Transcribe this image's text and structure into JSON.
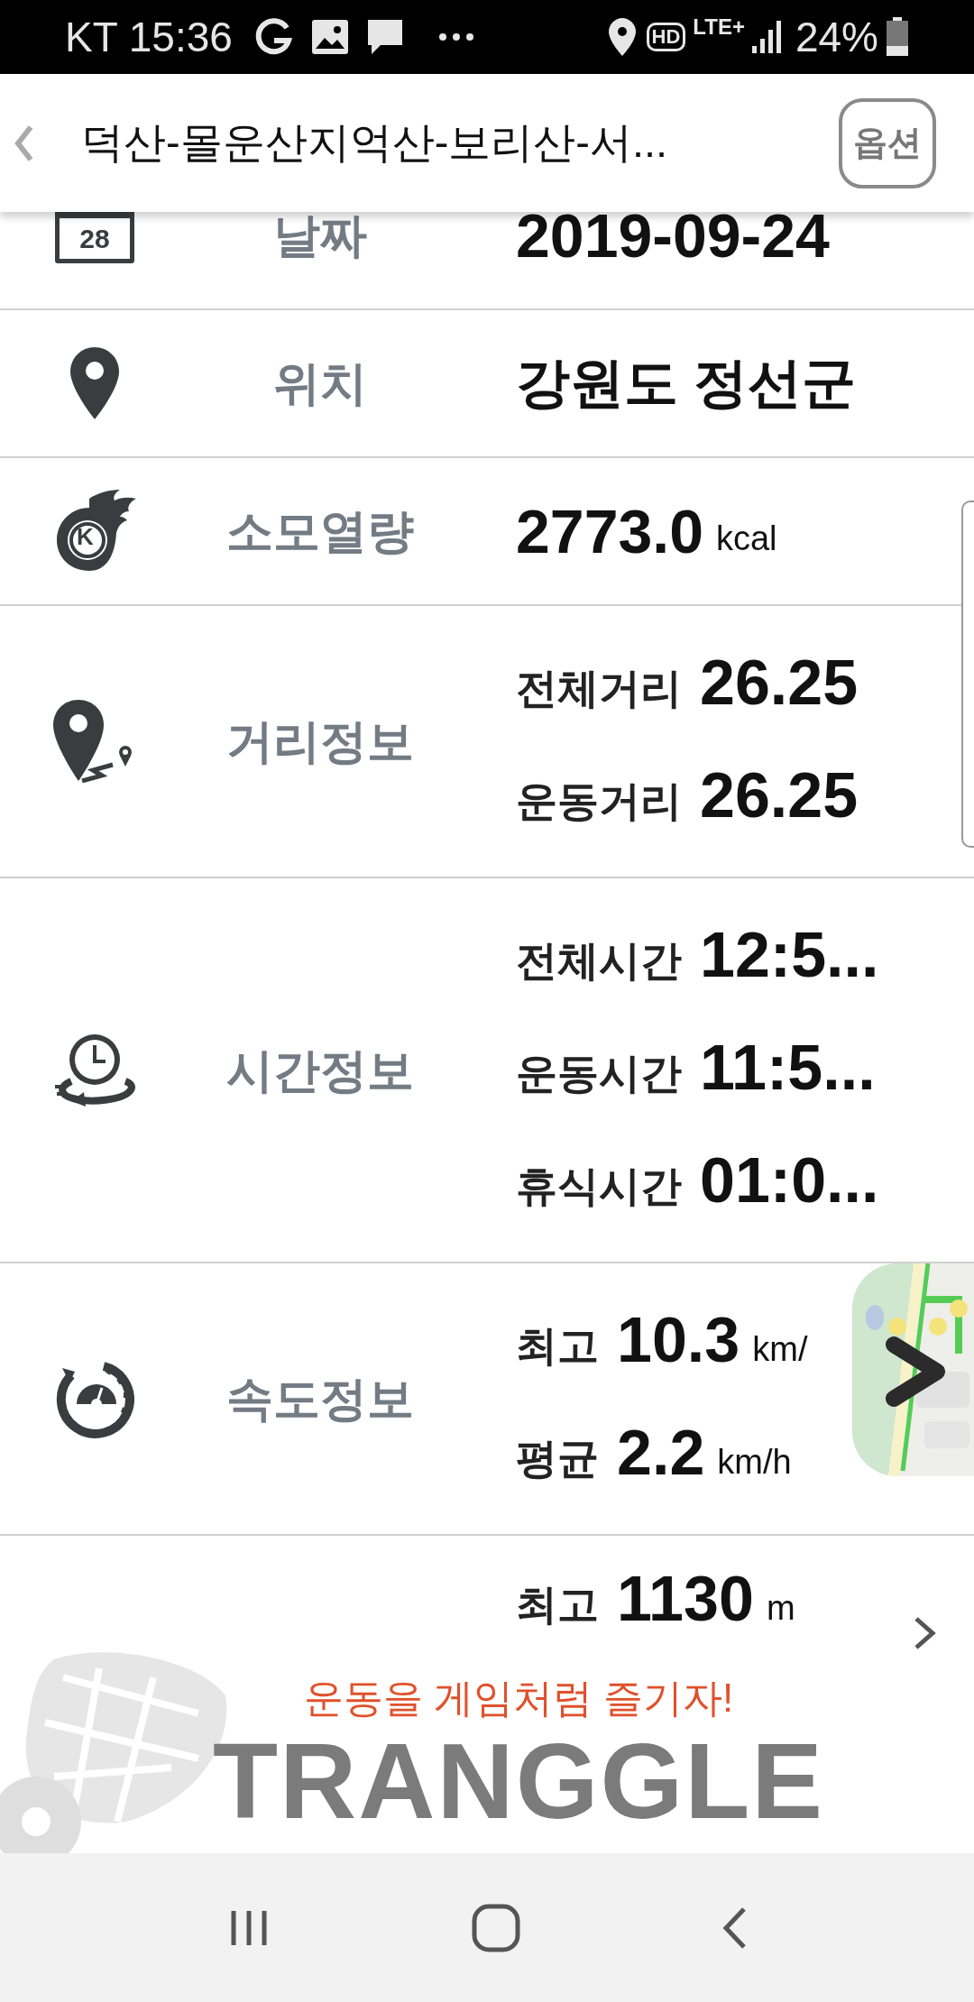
{
  "status_bar": {
    "carrier_time": "KT 15:36",
    "hd": "HD",
    "network": "LTE+",
    "battery": "24%"
  },
  "app_bar": {
    "title": "덕산-몰운산지억산-보리산-서...",
    "option_button": "옵션"
  },
  "rows": [
    {
      "kind": "single",
      "label": "날짜",
      "icon_text": "28",
      "value": "2019-09-24"
    },
    {
      "kind": "single",
      "label": "위치",
      "value": "강원도 정선군"
    },
    {
      "kind": "single",
      "label": "소모열량",
      "icon_text": "K",
      "value": "2773.0",
      "unit": "kcal"
    },
    {
      "kind": "multi",
      "label": "거리정보",
      "lines": [
        {
          "label": "전체거리",
          "value": "26.25"
        },
        {
          "label": "운동거리",
          "value": "26.25"
        }
      ]
    },
    {
      "kind": "multi",
      "label": "시간정보",
      "lines": [
        {
          "label": "전체시간",
          "value": "12:5..."
        },
        {
          "label": "운동시간",
          "value": "11:5..."
        },
        {
          "label": "휴식시간",
          "value": "01:0..."
        }
      ]
    },
    {
      "kind": "multi",
      "label": "속도정보",
      "map": true,
      "lines": [
        {
          "label": "최고",
          "value": "10.3",
          "unit": "km/"
        },
        {
          "label": "평균",
          "value": "2.2",
          "unit": "km/h"
        }
      ]
    },
    {
      "kind": "partial",
      "lines": [
        {
          "label": "최고",
          "value": "1130",
          "unit": "m"
        }
      ],
      "chevron": true
    }
  ],
  "banner": {
    "tagline": "운동을 게임처럼 즐기자!",
    "logo": "TRANGGLE"
  }
}
